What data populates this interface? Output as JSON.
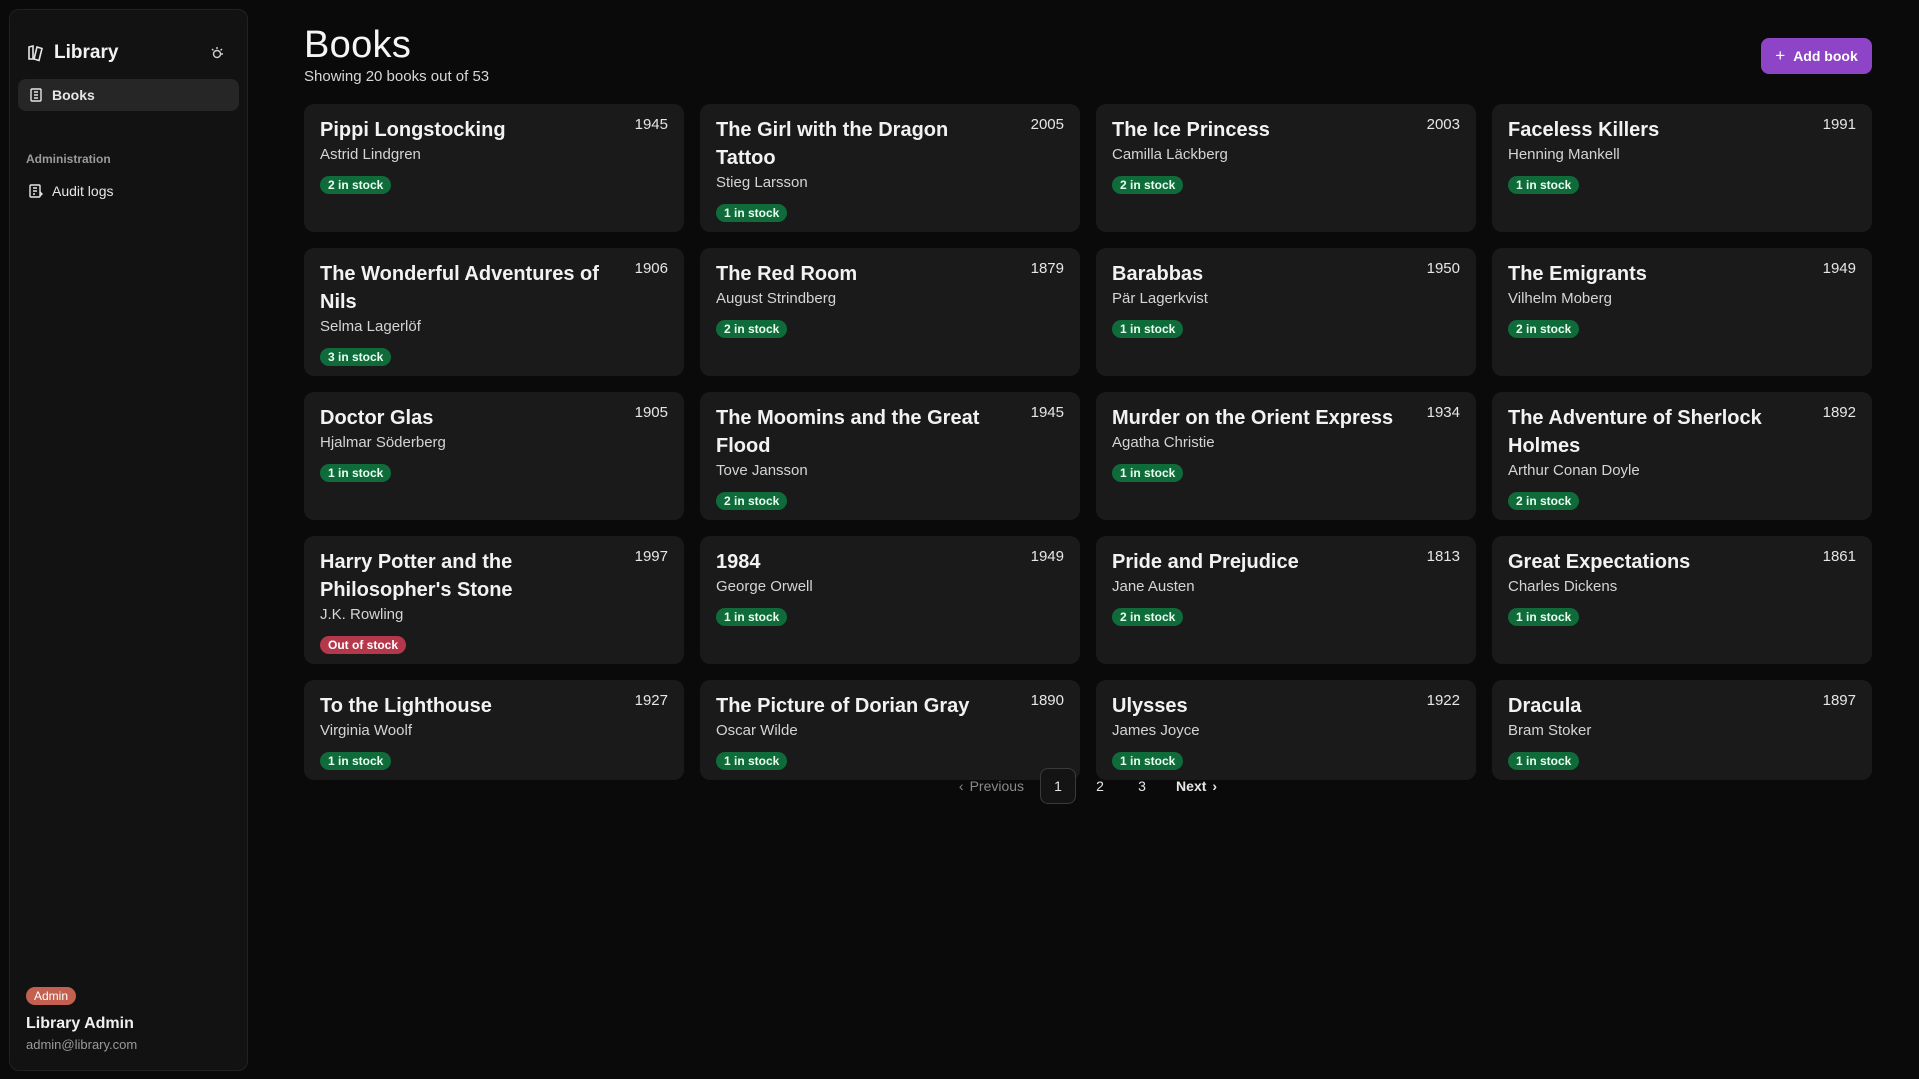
{
  "app": {
    "title": "Library"
  },
  "sidebar": {
    "nav_books": "Books",
    "section_admin": "Administration",
    "nav_audit": "Audit logs"
  },
  "user": {
    "role": "Admin",
    "name": "Library Admin",
    "email": "admin@library.com"
  },
  "page": {
    "title": "Books",
    "subtitle": "Showing 20 books out of 53",
    "add_label": "Add book"
  },
  "books": [
    {
      "title": "Pippi Longstocking",
      "year": "1945",
      "author": "Astrid Lindgren",
      "stock": "2 in stock",
      "in_stock": true
    },
    {
      "title": "The Girl with the Dragon Tattoo",
      "year": "2005",
      "author": "Stieg Larsson",
      "stock": "1 in stock",
      "in_stock": true
    },
    {
      "title": "The Ice Princess",
      "year": "2003",
      "author": "Camilla Läckberg",
      "stock": "2 in stock",
      "in_stock": true
    },
    {
      "title": "Faceless Killers",
      "year": "1991",
      "author": "Henning Mankell",
      "stock": "1 in stock",
      "in_stock": true
    },
    {
      "title": "The Wonderful Adventures of Nils",
      "year": "1906",
      "author": "Selma Lagerlöf",
      "stock": "3 in stock",
      "in_stock": true
    },
    {
      "title": "The Red Room",
      "year": "1879",
      "author": "August Strindberg",
      "stock": "2 in stock",
      "in_stock": true
    },
    {
      "title": "Barabbas",
      "year": "1950",
      "author": "Pär Lagerkvist",
      "stock": "1 in stock",
      "in_stock": true
    },
    {
      "title": "The Emigrants",
      "year": "1949",
      "author": "Vilhelm Moberg",
      "stock": "2 in stock",
      "in_stock": true
    },
    {
      "title": "Doctor Glas",
      "year": "1905",
      "author": "Hjalmar Söderberg",
      "stock": "1 in stock",
      "in_stock": true
    },
    {
      "title": "The Moomins and the Great Flood",
      "year": "1945",
      "author": "Tove Jansson",
      "stock": "2 in stock",
      "in_stock": true
    },
    {
      "title": "Murder on the Orient Express",
      "year": "1934",
      "author": "Agatha Christie",
      "stock": "1 in stock",
      "in_stock": true
    },
    {
      "title": "The Adventure of Sherlock Holmes",
      "year": "1892",
      "author": "Arthur Conan Doyle",
      "stock": "2 in stock",
      "in_stock": true
    },
    {
      "title": "Harry Potter and the Philosopher's Stone",
      "year": "1997",
      "author": "J.K. Rowling",
      "stock": "Out of stock",
      "in_stock": false
    },
    {
      "title": "1984",
      "year": "1949",
      "author": "George Orwell",
      "stock": "1 in stock",
      "in_stock": true
    },
    {
      "title": "Pride and Prejudice",
      "year": "1813",
      "author": "Jane Austen",
      "stock": "2 in stock",
      "in_stock": true
    },
    {
      "title": "Great Expectations",
      "year": "1861",
      "author": "Charles Dickens",
      "stock": "1 in stock",
      "in_stock": true
    },
    {
      "title": "To the Lighthouse",
      "year": "1927",
      "author": "Virginia Woolf",
      "stock": "1 in stock",
      "in_stock": true
    },
    {
      "title": "The Picture of Dorian Gray",
      "year": "1890",
      "author": "Oscar Wilde",
      "stock": "1 in stock",
      "in_stock": true
    },
    {
      "title": "Ulysses",
      "year": "1922",
      "author": "James Joyce",
      "stock": "1 in stock",
      "in_stock": true
    },
    {
      "title": "Dracula",
      "year": "1897",
      "author": "Bram Stoker",
      "stock": "1 in stock",
      "in_stock": true
    }
  ],
  "pagination": {
    "previous": "Previous",
    "next": "Next",
    "pages": [
      "1",
      "2",
      "3"
    ],
    "current": "1"
  },
  "colors": {
    "accent": "#8e44c6",
    "in_stock": "#0f6b3a",
    "out_of_stock": "#b5384a",
    "admin_badge": "#c4604f"
  }
}
